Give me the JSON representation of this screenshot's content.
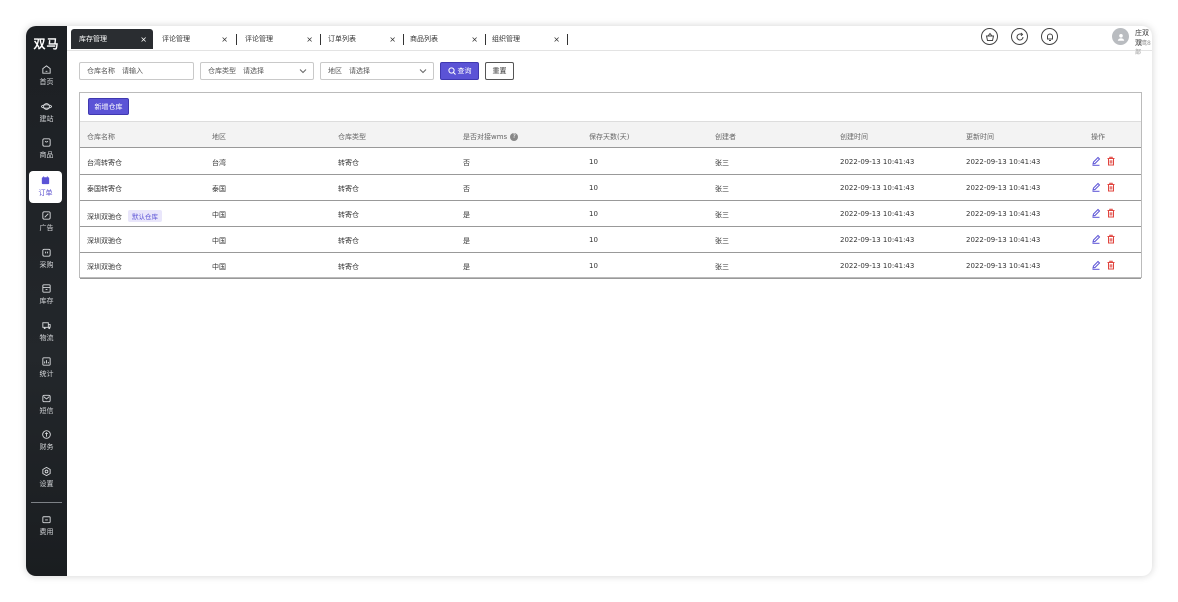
{
  "app": {
    "logo": "双马"
  },
  "sidebar": {
    "items": [
      {
        "label": "首页",
        "icon": "home-icon"
      },
      {
        "label": "建站",
        "icon": "planet-icon"
      },
      {
        "label": "商品",
        "icon": "bag-icon"
      },
      {
        "label": "订单",
        "icon": "calendar-icon",
        "active": true
      },
      {
        "label": "广告",
        "icon": "edit-icon"
      },
      {
        "label": "采购",
        "icon": "cart-icon"
      },
      {
        "label": "库存",
        "icon": "box-icon"
      },
      {
        "label": "物流",
        "icon": "truck-icon"
      },
      {
        "label": "统计",
        "icon": "chart-icon"
      },
      {
        "label": "短信",
        "icon": "message-icon"
      },
      {
        "label": "财务",
        "icon": "coin-icon"
      },
      {
        "label": "设置",
        "icon": "gear-icon"
      },
      {
        "label": "费用",
        "icon": "wallet-icon"
      }
    ]
  },
  "tabs": [
    {
      "label": "库存管理",
      "active": true
    },
    {
      "label": "评论管理"
    },
    {
      "label": "评论管理"
    },
    {
      "label": "订单列表"
    },
    {
      "label": "商品列表"
    },
    {
      "label": "组织管理"
    }
  ],
  "header": {
    "user_name": "庄双双",
    "user_dept": "双鹰8部"
  },
  "filters": {
    "warehouse_name": {
      "label": "仓库名称",
      "placeholder": "请输入"
    },
    "warehouse_type": {
      "label": "仓库类型",
      "placeholder": "请选择"
    },
    "region": {
      "label": "地区",
      "placeholder": "请选择"
    },
    "search_label": "查询",
    "reset_label": "重置"
  },
  "toolbar": {
    "new_label": "新增仓库"
  },
  "table": {
    "columns": [
      "仓库名称",
      "地区",
      "仓库类型",
      "是否对接wms",
      "保存天数(天)",
      "创建者",
      "创建时间",
      "更新时间",
      "操作"
    ],
    "rows": [
      {
        "name": "台湾转寄仓",
        "tag": "",
        "region": "台湾",
        "type": "转寄仓",
        "wms": "否",
        "days": "10",
        "creator": "张三",
        "created": "2022-09-13 10:41:43",
        "updated": "2022-09-13 10:41:43"
      },
      {
        "name": "泰国转寄仓",
        "tag": "",
        "region": "泰国",
        "type": "转寄仓",
        "wms": "否",
        "days": "10",
        "creator": "张三",
        "created": "2022-09-13 10:41:43",
        "updated": "2022-09-13 10:41:43"
      },
      {
        "name": "深圳双驰仓",
        "tag": "默认仓库",
        "region": "中国",
        "type": "转寄仓",
        "wms": "是",
        "days": "10",
        "creator": "张三",
        "created": "2022-09-13 10:41:43",
        "updated": "2022-09-13 10:41:43"
      },
      {
        "name": "深圳双驰仓",
        "tag": "",
        "region": "中国",
        "type": "转寄仓",
        "wms": "是",
        "days": "10",
        "creator": "张三",
        "created": "2022-09-13 10:41:43",
        "updated": "2022-09-13 10:41:43"
      },
      {
        "name": "深圳双驰仓",
        "tag": "",
        "region": "中国",
        "type": "转寄仓",
        "wms": "是",
        "days": "10",
        "creator": "张三",
        "created": "2022-09-13 10:41:43",
        "updated": "2022-09-13 10:41:43"
      }
    ]
  },
  "colors": {
    "primary": "#5b53d6",
    "sidebar_bg": "#1c1f23",
    "delete": "#e0443e"
  }
}
